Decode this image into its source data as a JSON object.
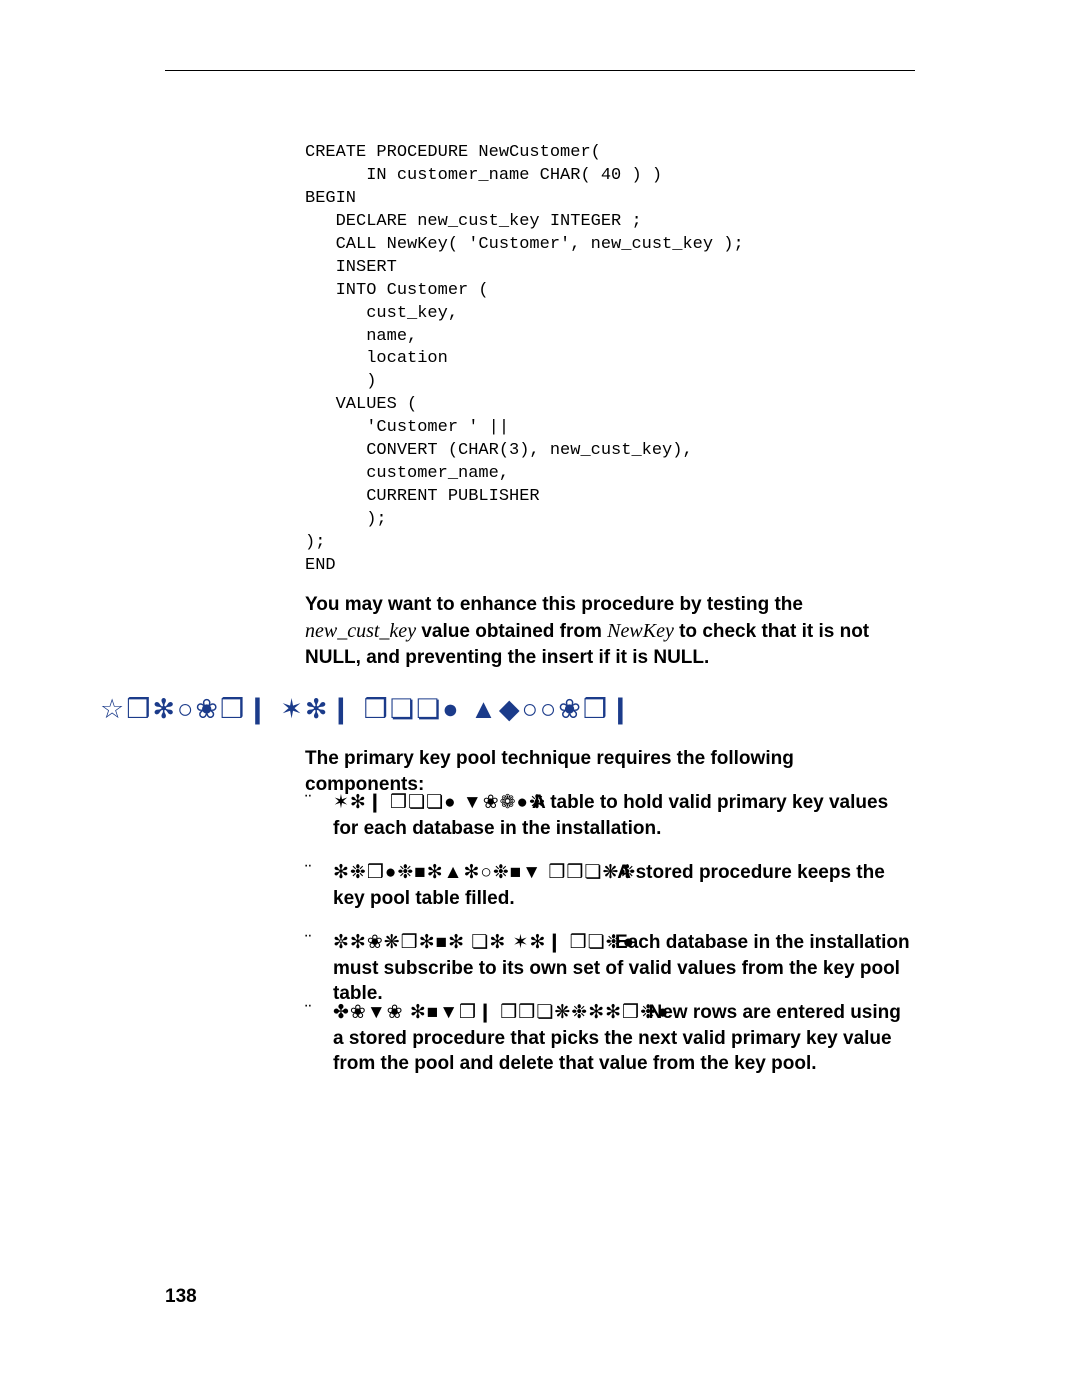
{
  "code": "CREATE PROCEDURE NewCustomer(\n      IN customer_name CHAR( 40 ) )\nBEGIN\n   DECLARE new_cust_key INTEGER ;\n   CALL NewKey( 'Customer', new_cust_key );\n   INSERT\n   INTO Customer (\n      cust_key,\n      name,\n      location\n      )\n   VALUES (\n      'Customer ' ||\n      CONVERT (CHAR(3), new_cust_key),\n      customer_name,\n      CURRENT PUBLISHER\n      );\n);\nEND",
  "paragraph1": {
    "a": "You may want to enhance this procedure by testing the ",
    "i1": "new_cust_key",
    "b": " value obtained from ",
    "i2": "NewKey",
    "c": " to check that it is not NULL, and preventing the insert if it is NULL."
  },
  "heading": "☆❒✻○❀❒❙ ✶✻❙ ❒❏❏● ▲◆○○❀❒❙",
  "paragraph2": "The primary key pool technique requires the following components:",
  "bullets": [
    {
      "mark": "¨",
      "glyph": "✶✻❙ ❒❏❏● ▼❀❁●❉",
      "text_prefix": "A table",
      "text": " to hold valid primary key values for each database in the installation."
    },
    {
      "mark": "¨",
      "glyph": "✻❉❒●❉■✻▲✻○❉■▼ ❒❒❏❋❉",
      "text_prefix": "A stored",
      "text": " procedure keeps the key pool table filled."
    },
    {
      "mark": "¨",
      "glyph": "✼✻❀❋❒✻■✻ ❏✻ ✶✻❙ ❒❏❉●",
      "text_prefix": "Each",
      "text": " database in the installation must subscribe to its own set of valid values from the key pool table."
    },
    {
      "mark": "¨",
      "glyph": "✤❀▼❀ ✻■▼❒❙ ❒❒❏❋❉✻✻❒❉●",
      "text_prefix": "New rows",
      "text": " are entered using a stored procedure that picks the next valid primary key value from the pool and delete that value from the key pool."
    }
  ],
  "pageNumber": "138"
}
